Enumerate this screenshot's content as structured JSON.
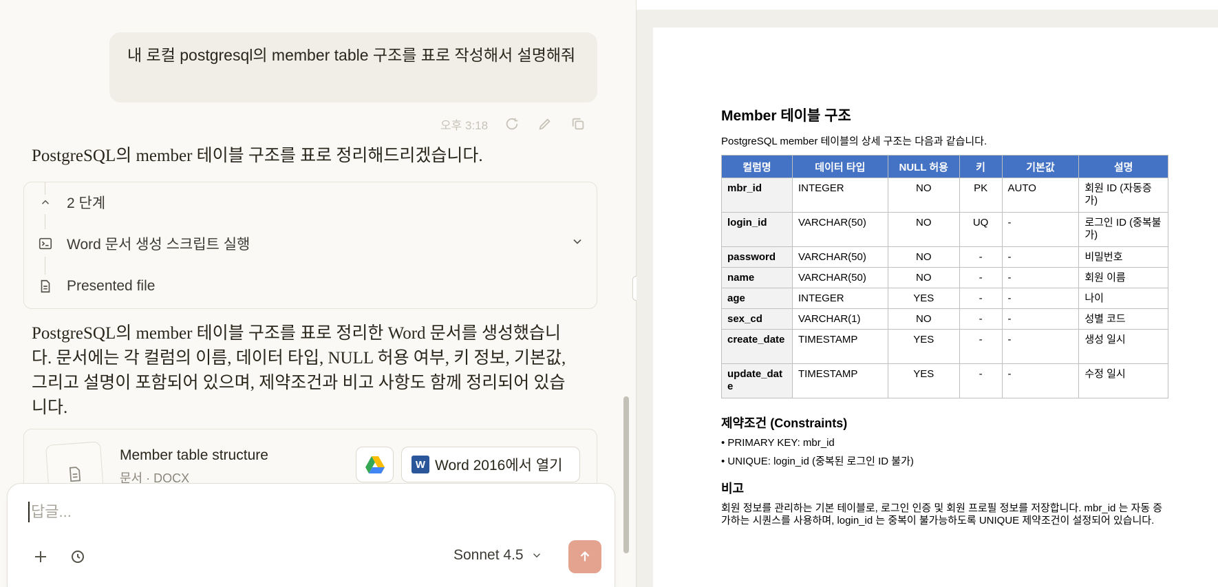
{
  "chat": {
    "user_message": "내 로컬 postgresql의 member table 구조를 표로 작성해서 설명해줘",
    "timestamp": "오후 3:18",
    "assistant_intro": "PostgreSQL의 member 테이블 구조를 표로 정리해드리겠습니다.",
    "steps": {
      "count_label": "2 단계",
      "items": [
        {
          "label": "Word 문서 생성 스크립트 실행",
          "icon": "terminal-icon"
        },
        {
          "label": "Presented file",
          "icon": "document-icon"
        }
      ]
    },
    "assistant_summary": "PostgreSQL의 member 테이블 구조를 표로 정리한 Word 문서를 생성했습니다. 문서에는 각 컬럼의 이름, 데이터 타입, NULL 허용 여부, 키 정보, 기본값, 그리고 설명이 포함되어 있으며, 제약조건과 비고 사항도 함께 정리되어 있습니다.",
    "file": {
      "title": "Member table structure",
      "subtitle": "문서 · DOCX",
      "open_label": "Word 2016에서 열기",
      "word_logo": "W"
    }
  },
  "composer": {
    "placeholder": "답글...",
    "model": "Sonnet 4.5"
  },
  "document": {
    "title": "Member 테이블 구조",
    "intro": "PostgreSQL member 테이블의 상세 구조는 다음과 같습니다.",
    "table": {
      "headers": [
        "컬럼명",
        "데이터 타입",
        "NULL 허용",
        "키",
        "기본값",
        "설명"
      ],
      "rows": [
        [
          "mbr_id",
          "INTEGER",
          "NO",
          "PK",
          "AUTO",
          "회원 ID (자동증가)"
        ],
        [
          "login_id",
          "VARCHAR(50)",
          "NO",
          "UQ",
          "-",
          "로그인 ID (중복불가)"
        ],
        [
          "password",
          "VARCHAR(50)",
          "NO",
          "-",
          "-",
          "비밀번호"
        ],
        [
          "name",
          "VARCHAR(50)",
          "NO",
          "-",
          "-",
          "회원 이름"
        ],
        [
          "age",
          "INTEGER",
          "YES",
          "-",
          "-",
          "나이"
        ],
        [
          "sex_cd",
          "VARCHAR(1)",
          "NO",
          "-",
          "-",
          "성별 코드"
        ],
        [
          "create_date",
          "TIMESTAMP",
          "YES",
          "-",
          "-",
          "생성 일시"
        ],
        [
          "update_date",
          "TIMESTAMP",
          "YES",
          "-",
          "-",
          "수정 일시"
        ]
      ]
    },
    "constraints_title": "제약조건 (Constraints)",
    "constraints": [
      "• PRIMARY KEY: mbr_id",
      "• UNIQUE: login_id (중복된 로그인 ID 불가)"
    ],
    "notes_title": "비고",
    "notes": "회원 정보를 관리하는 기본 테이블로, 로그인 인증 및 회원 프로필 정보를 저장합니다. mbr_id 는 자동 증가하는 시퀀스를 사용하며, login_id 는 중복이 불가능하도록 UNIQUE 제약조건이 설정되어 있습니다."
  },
  "colors": {
    "table_header": "#4472c4",
    "send_button": "#e3a38e",
    "chat_bg": "#faf9f5"
  }
}
